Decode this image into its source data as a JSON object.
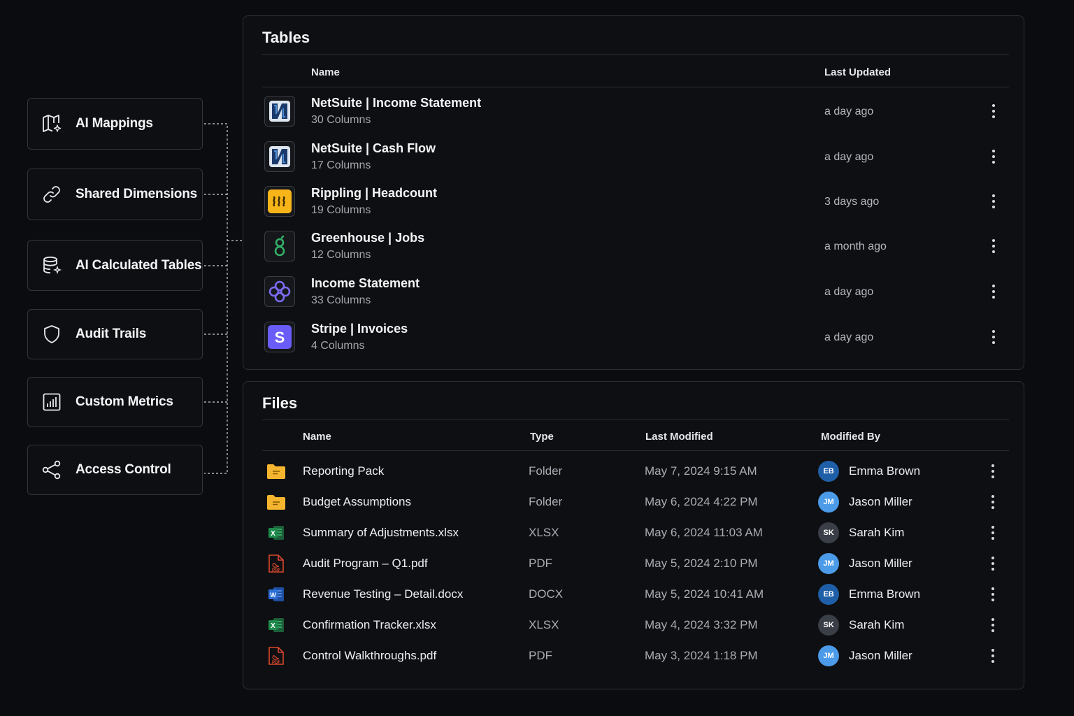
{
  "features": [
    {
      "label": "AI Mappings",
      "icon": "map-sparkle-icon"
    },
    {
      "label": "Shared Dimensions",
      "icon": "link-icon"
    },
    {
      "label": "AI Calculated Tables",
      "icon": "database-sparkle-icon"
    },
    {
      "label": "Audit Trails",
      "icon": "shield-icon"
    },
    {
      "label": "Custom Metrics",
      "icon": "bar-chart-icon"
    },
    {
      "label": "Access Control",
      "icon": "share-nodes-icon"
    }
  ],
  "tables": {
    "title": "Tables",
    "headers": {
      "name": "Name",
      "last_updated": "Last Updated"
    },
    "rows": [
      {
        "name": "NetSuite | Income Statement",
        "columns": "30 Columns",
        "updated": "a day ago",
        "logo": "netsuite-logo-icon",
        "logo_text": "N"
      },
      {
        "name": "NetSuite | Cash Flow",
        "columns": "17 Columns",
        "updated": "a day ago",
        "logo": "netsuite-logo-icon",
        "logo_text": "N"
      },
      {
        "name": "Rippling | Headcount",
        "columns": "19 Columns",
        "updated": "3 days ago",
        "logo": "rippling-logo-icon",
        "logo_text": "≀≀≀"
      },
      {
        "name": "Greenhouse | Jobs",
        "columns": "12 Columns",
        "updated": "a month ago",
        "logo": "greenhouse-logo-icon",
        "logo_text": "g"
      },
      {
        "name": "Income Statement",
        "columns": "33 Columns",
        "updated": "a day ago",
        "logo": "ai-calculated-table-logo-icon",
        "logo_text": ""
      },
      {
        "name": "Stripe | Invoices",
        "columns": "4 Columns",
        "updated": "a day ago",
        "logo": "stripe-logo-icon",
        "logo_text": "S"
      }
    ]
  },
  "files": {
    "title": "Files",
    "headers": {
      "name": "Name",
      "type": "Type",
      "last_modified": "Last Modified",
      "modified_by": "Modified By"
    },
    "rows": [
      {
        "name": "Reporting Pack",
        "type": "Folder",
        "modified": "May 7, 2024 9:15 AM",
        "by": "Emma Brown",
        "initials": "EB",
        "icon": "folder-icon"
      },
      {
        "name": "Budget Assumptions",
        "type": "Folder",
        "modified": "May 6, 2024 4:22 PM",
        "by": "Jason Miller",
        "initials": "JM",
        "icon": "folder-icon"
      },
      {
        "name": "Summary of Adjustments.xlsx",
        "type": "XLSX",
        "modified": "May 6, 2024 11:03 AM",
        "by": "Sarah Kim",
        "initials": "SK",
        "icon": "excel-file-icon"
      },
      {
        "name": "Audit Program – Q1.pdf",
        "type": "PDF",
        "modified": "May 5, 2024 2:10 PM",
        "by": "Jason Miller",
        "initials": "JM",
        "icon": "pdf-file-icon"
      },
      {
        "name": "Revenue Testing – Detail.docx",
        "type": "DOCX",
        "modified": "May 5, 2024 10:41 AM",
        "by": "Emma Brown",
        "initials": "EB",
        "icon": "word-file-icon"
      },
      {
        "name": "Confirmation Tracker.xlsx",
        "type": "XLSX",
        "modified": "May 4, 2024 3:32 PM",
        "by": "Sarah Kim",
        "initials": "SK",
        "icon": "excel-file-icon"
      },
      {
        "name": "Control Walkthroughs.pdf",
        "type": "PDF",
        "modified": "May 3, 2024 1:18 PM",
        "by": "Jason Miller",
        "initials": "JM",
        "icon": "pdf-file-icon"
      }
    ]
  },
  "colors": {
    "background": "#0b0c0f",
    "panel": "#0e0f12",
    "border": "#2d2f35",
    "avatar_EB": "#1f5fa8",
    "avatar_JM": "#4b9be8",
    "avatar_SK": "#3a3e47",
    "folder": "#f5b52e",
    "excel": "#1e8a4c",
    "pdf": "#d9492e",
    "word": "#2b6fd6",
    "stripe": "#6a5cf6",
    "rippling": "#f7b519"
  }
}
